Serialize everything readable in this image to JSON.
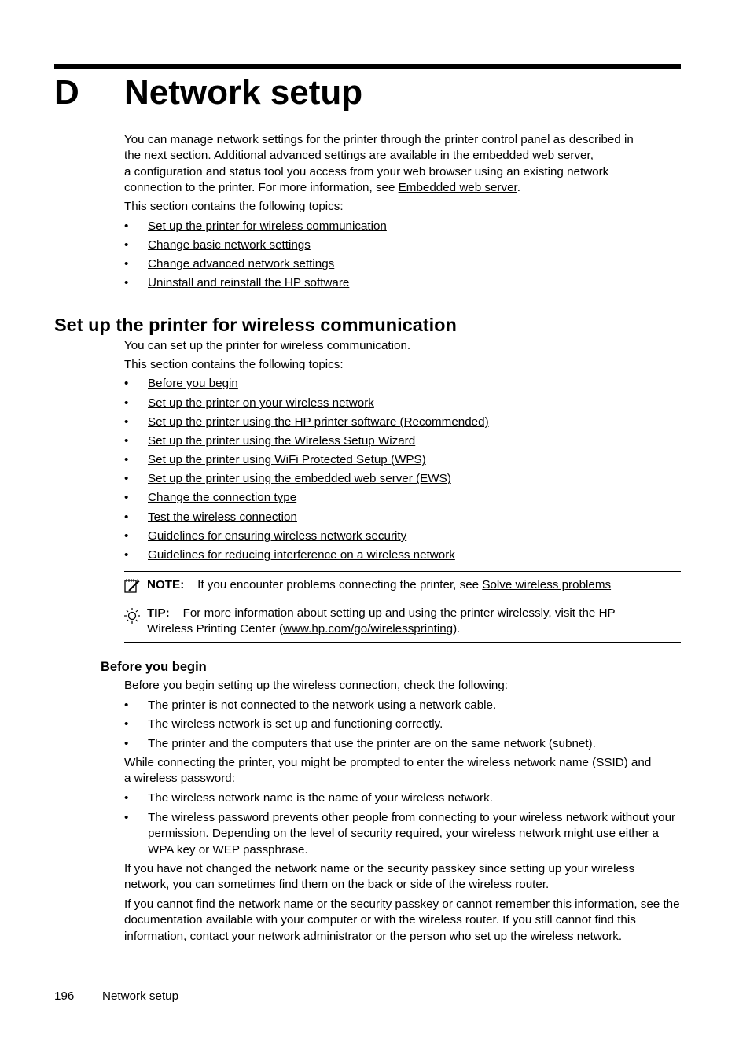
{
  "chapter": {
    "letter": "D",
    "title": "Network setup"
  },
  "intro": {
    "paragraph_lines": [
      "You can manage network settings for the printer through the printer control panel as described in",
      "the next section. Additional advanced settings are available in the embedded web server,",
      "a configuration and status tool you access from your web browser using an existing network"
    ],
    "last_line_prefix": "connection to the printer. For more information, see ",
    "last_line_link": "Embedded web server",
    "last_line_suffix": ".",
    "topics_label": "This section contains the following topics:",
    "topics": [
      "Set up the printer for wireless communication",
      "Change basic network settings",
      "Change advanced network settings",
      "Uninstall and reinstall the HP software"
    ]
  },
  "section": {
    "heading": "Set up the printer for wireless communication",
    "intro": "You can set up the printer for wireless communication.",
    "topics_label": "This section contains the following topics:",
    "topics": [
      "Before you begin",
      "Set up the printer on your wireless network",
      "Set up the printer using the HP printer software (Recommended)",
      "Set up the printer using the Wireless Setup Wizard",
      "Set up the printer using WiFi Protected Setup (WPS)",
      "Set up the printer using the embedded web server (EWS)",
      "Change the connection type",
      "Test the wireless connection",
      "Guidelines for ensuring wireless network security",
      "Guidelines for reducing interference on a wireless network"
    ],
    "note": {
      "label": "NOTE:",
      "text": "If you encounter problems connecting the printer, see ",
      "link": "Solve wireless problems"
    },
    "tip": {
      "label": "TIP:",
      "text_line1": "For more information about setting up and using the printer wirelessly, visit the HP",
      "text_line2_prefix": "Wireless Printing Center (",
      "link": "www.hp.com/go/wirelessprinting",
      "text_line2_suffix": ")."
    }
  },
  "subsection": {
    "heading": "Before you begin",
    "intro": "Before you begin setting up the wireless connection, check the following:",
    "checks": [
      "The printer is not connected to the network using a network cable.",
      "The wireless network is set up and functioning correctly.",
      "The printer and the computers that use the printer are on the same network (subnet)."
    ],
    "prompt_lines": [
      "While connecting the printer, you might be prompted to enter the wireless network name (SSID) and",
      "a wireless password:"
    ],
    "prompt_items": [
      "The wireless network name is the name of your wireless network.",
      "The wireless password prevents other people from connecting to your wireless network without your permission. Depending on the level of security required, your wireless network might use either a WPA key or WEP passphrase."
    ],
    "para1": "If you have not changed the network name or the security passkey since setting up your wireless network, you can sometimes find them on the back or side of the wireless router.",
    "para2": "If you cannot find the network name or the security passkey or cannot remember this information, see the documentation available with your computer or with the wireless router. If you still cannot find this information, contact your network administrator or the person who set up the wireless network."
  },
  "footer": {
    "page_number": "196",
    "section_name": "Network setup"
  },
  "bullet_char": "•"
}
